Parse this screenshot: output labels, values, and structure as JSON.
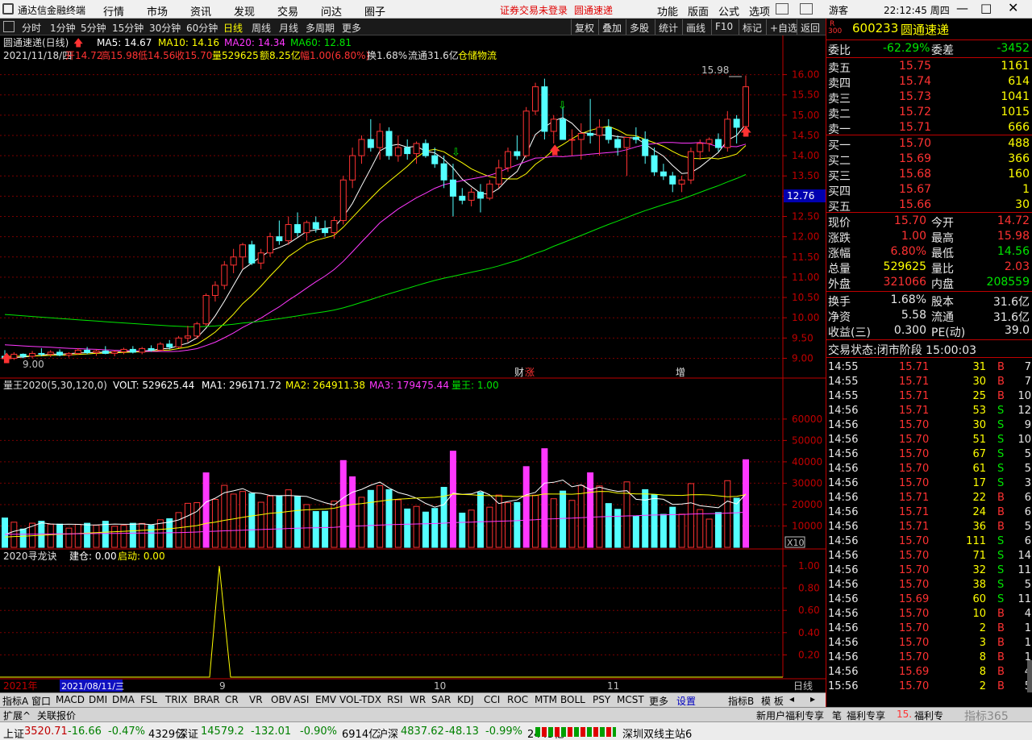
{
  "app": {
    "logo_label": "通达信金融终端",
    "menu": [
      "行情",
      "市场",
      "资讯",
      "发现",
      "交易",
      "问达",
      "圈子"
    ],
    "notice": "证券交易未登录",
    "notice_name": "圆通速递",
    "right_menu": [
      "功能",
      "版面",
      "公式",
      "选项"
    ],
    "user": "游客",
    "clock": "22:12:45 周四"
  },
  "periods": [
    "分时",
    "1分钟",
    "5分钟",
    "15分钟",
    "30分钟",
    "60分钟",
    "日线",
    "周线",
    "月线",
    "多周期",
    "更多"
  ],
  "active_period": "日线",
  "right_tools": [
    "复权",
    "叠加",
    "多股",
    "统计",
    "画线",
    "F10",
    "标记",
    "+自选",
    "返回"
  ],
  "main": {
    "name": "圆通速递(日线)",
    "ma5": "MA5: 14.67",
    "ma10": "MA10: 14.16",
    "ma20": "MA20: 14.34",
    "ma60": "MA60: 12.81",
    "info_date": "2021/11/18/四",
    "info_open": "开14.72",
    "info_high": "高15.98",
    "info_low": "低14.56",
    "info_close": "收15.70",
    "info_vol": "量529625",
    "info_amt": "额8.25亿",
    "info_pct": "幅1.00(6.80%)",
    "info_turn": "换1.68%",
    "info_float": "流通31.6亿",
    "info_sector": "仓储物流",
    "hi_label": "15.98",
    "lo_label": "9.00",
    "price_tag": "12.76",
    "mark_cai": "财",
    "mark_zhang": "涨",
    "mark_zeng": "增"
  },
  "vol": {
    "name": "量王2020(5,30,120,0)",
    "volt": "VOLT: 529625.44",
    "ma1": "MA1: 296171.72",
    "ma2": "MA2: 264911.38",
    "ma3": "MA3: 179475.44",
    "wang": "量王: 1.00",
    "unit": "X10"
  },
  "ind": {
    "name": "2020寻龙诀",
    "jiancang": "建仓: 0.00",
    "qidong": "启动: 0.00"
  },
  "xaxis": {
    "year": "2021年",
    "cursor_date": "2021/08/11/三",
    "m9": "9",
    "m10": "10",
    "m11": "11",
    "period": "日线"
  },
  "chart_data": {
    "type": "candlestick",
    "y_ticks": [
      16.0,
      15.5,
      15.0,
      14.5,
      14.0,
      13.5,
      13.0,
      12.5,
      12.0,
      11.5,
      11.0,
      10.5,
      10.0,
      9.5,
      9.0
    ],
    "ylim": [
      8.85,
      16.25
    ],
    "candles": [
      [
        9.05,
        9.2,
        8.97,
        9.0
      ],
      [
        9.0,
        9.15,
        8.96,
        9.1
      ],
      [
        9.1,
        9.12,
        9.0,
        9.05
      ],
      [
        9.05,
        9.18,
        9.0,
        9.12
      ],
      [
        9.12,
        9.25,
        9.05,
        9.1
      ],
      [
        9.1,
        9.2,
        9.03,
        9.15
      ],
      [
        9.15,
        9.22,
        9.05,
        9.08
      ],
      [
        9.08,
        9.15,
        9.02,
        9.12
      ],
      [
        9.12,
        9.25,
        9.08,
        9.2
      ],
      [
        9.2,
        9.28,
        9.1,
        9.14
      ],
      [
        9.14,
        9.22,
        9.06,
        9.18
      ],
      [
        9.18,
        9.3,
        9.1,
        9.12
      ],
      [
        9.12,
        9.2,
        9.05,
        9.16
      ],
      [
        9.16,
        9.26,
        9.1,
        9.22
      ],
      [
        9.22,
        9.3,
        9.12,
        9.15
      ],
      [
        9.15,
        9.28,
        9.1,
        9.24
      ],
      [
        9.24,
        9.32,
        9.16,
        9.2
      ],
      [
        9.2,
        9.4,
        9.18,
        9.35
      ],
      [
        9.35,
        9.45,
        9.22,
        9.28
      ],
      [
        9.28,
        9.55,
        9.25,
        9.5
      ],
      [
        9.5,
        9.8,
        9.4,
        9.55
      ],
      [
        9.55,
        9.9,
        9.48,
        9.85
      ],
      [
        9.85,
        10.6,
        9.8,
        10.55
      ],
      [
        10.55,
        10.9,
        10.4,
        10.8
      ],
      [
        10.8,
        11.4,
        10.7,
        11.3
      ],
      [
        11.3,
        11.7,
        11.1,
        11.5
      ],
      [
        11.5,
        11.85,
        11.2,
        11.8
      ],
      [
        11.8,
        11.9,
        11.3,
        11.35
      ],
      [
        11.35,
        11.7,
        11.2,
        11.6
      ],
      [
        11.6,
        12.1,
        11.5,
        12.0
      ],
      [
        12.0,
        12.4,
        11.8,
        11.9
      ],
      [
        11.9,
        12.5,
        11.8,
        12.3
      ],
      [
        12.3,
        12.6,
        12.0,
        12.1
      ],
      [
        12.1,
        12.4,
        11.9,
        12.35
      ],
      [
        12.35,
        12.5,
        12.1,
        12.2
      ],
      [
        12.2,
        12.4,
        12.0,
        12.1
      ],
      [
        12.1,
        12.5,
        11.95,
        12.4
      ],
      [
        12.4,
        13.5,
        12.3,
        13.4
      ],
      [
        13.4,
        14.2,
        13.2,
        14.0
      ],
      [
        14.0,
        14.5,
        13.8,
        14.4
      ],
      [
        14.4,
        14.9,
        14.1,
        14.2
      ],
      [
        14.2,
        14.8,
        13.9,
        14.6
      ],
      [
        14.6,
        14.7,
        13.9,
        14.0
      ],
      [
        14.0,
        14.5,
        13.85,
        14.2
      ],
      [
        14.2,
        14.4,
        13.9,
        14.05
      ],
      [
        14.05,
        14.35,
        13.8,
        14.3
      ],
      [
        14.3,
        14.4,
        13.95,
        14.0
      ],
      [
        14.0,
        14.2,
        13.7,
        13.8
      ],
      [
        13.8,
        14.0,
        13.2,
        13.4
      ],
      [
        13.4,
        13.8,
        12.5,
        13.0
      ],
      [
        13.0,
        13.2,
        12.8,
        12.9
      ],
      [
        12.9,
        13.2,
        12.75,
        13.1
      ],
      [
        13.1,
        13.3,
        12.6,
        12.95
      ],
      [
        12.95,
        13.4,
        12.9,
        13.3
      ],
      [
        13.3,
        13.9,
        13.2,
        13.7
      ],
      [
        13.7,
        14.2,
        13.6,
        14.1
      ],
      [
        14.1,
        14.5,
        13.9,
        14.0
      ],
      [
        14.0,
        15.2,
        13.95,
        15.1
      ],
      [
        15.1,
        15.8,
        15.0,
        15.7
      ],
      [
        15.7,
        15.9,
        14.4,
        14.6
      ],
      [
        14.6,
        15.0,
        14.3,
        14.9
      ],
      [
        14.9,
        15.2,
        14.4,
        14.4
      ],
      [
        14.4,
        14.65,
        14.0,
        14.4
      ],
      [
        14.4,
        14.8,
        13.9,
        14.55
      ],
      [
        14.55,
        15.4,
        14.3,
        14.5
      ],
      [
        14.5,
        14.9,
        14.0,
        14.7
      ],
      [
        14.7,
        14.9,
        14.3,
        14.4
      ],
      [
        14.4,
        14.5,
        14.0,
        14.2
      ],
      [
        14.2,
        14.45,
        13.5,
        14.45
      ],
      [
        14.45,
        14.7,
        14.3,
        14.4
      ],
      [
        14.4,
        14.6,
        13.8,
        14.0
      ],
      [
        14.0,
        14.2,
        13.5,
        13.6
      ],
      [
        13.6,
        13.8,
        13.4,
        13.5
      ],
      [
        13.5,
        13.6,
        13.1,
        13.3
      ],
      [
        13.3,
        13.5,
        13.1,
        13.4
      ],
      [
        13.4,
        14.2,
        13.3,
        14.1
      ],
      [
        14.1,
        14.4,
        13.9,
        14.3
      ],
      [
        14.3,
        14.45,
        14.1,
        14.4
      ],
      [
        14.4,
        14.55,
        14.1,
        14.2
      ],
      [
        14.2,
        15.1,
        14.1,
        14.9
      ],
      [
        14.9,
        15.0,
        14.3,
        14.7
      ],
      [
        14.72,
        15.98,
        14.56,
        15.7
      ]
    ],
    "ma_series": [
      {
        "name": "MA5",
        "color": "#ffffff"
      },
      {
        "name": "MA10",
        "color": "#ffff00"
      },
      {
        "name": "MA20",
        "color": "#ff38ff"
      },
      {
        "name": "MA60",
        "color": "#00e600"
      }
    ],
    "vol_ticks": [
      60000,
      50000,
      40000,
      30000,
      20000,
      10000
    ],
    "vol_ylim": [
      0,
      69000
    ],
    "ind_ticks": [
      1.0,
      0.8,
      0.6,
      0.4,
      0.2
    ]
  },
  "quote": {
    "code": "600233",
    "name": "圆通速递",
    "r_mark": "R",
    "market_no": "300",
    "wb_label": "委比",
    "wb": "-62.29%",
    "wc_label": "委差",
    "wc": "-3452",
    "asks": [
      {
        "label": "卖五",
        "price": "15.75",
        "vol": "1161"
      },
      {
        "label": "卖四",
        "price": "15.74",
        "vol": "614"
      },
      {
        "label": "卖三",
        "price": "15.73",
        "vol": "1041"
      },
      {
        "label": "卖二",
        "price": "15.72",
        "vol": "1015"
      },
      {
        "label": "卖一",
        "price": "15.71",
        "vol": "666"
      }
    ],
    "bids": [
      {
        "label": "买一",
        "price": "15.70",
        "vol": "488"
      },
      {
        "label": "买二",
        "price": "15.69",
        "vol": "366"
      },
      {
        "label": "买三",
        "price": "15.68",
        "vol": "160"
      },
      {
        "label": "买四",
        "price": "15.67",
        "vol": "1"
      },
      {
        "label": "买五",
        "price": "15.66",
        "vol": "30"
      }
    ],
    "stats": [
      [
        "现价",
        "15.70",
        "今开",
        "14.72"
      ],
      [
        "涨跌",
        "1.00",
        "最高",
        "15.98"
      ],
      [
        "涨幅",
        "6.80%",
        "最低",
        "14.56"
      ],
      [
        "总量",
        "529625",
        "量比",
        "2.03"
      ],
      [
        "外盘",
        "321066",
        "内盘",
        "208559"
      ]
    ],
    "stats2": [
      [
        "换手",
        "1.68%",
        "股本",
        "31.6亿"
      ],
      [
        "净资",
        "5.58",
        "流通",
        "31.6亿"
      ],
      [
        "收益(三)",
        "0.300",
        "PE(动)",
        "39.0"
      ]
    ],
    "trade_status": "交易状态:闭市阶段 15:00:03"
  },
  "ticks": [
    [
      "14:55",
      "15.71",
      "31",
      "B",
      "7"
    ],
    [
      "14:55",
      "15.71",
      "30",
      "B",
      "7"
    ],
    [
      "14:55",
      "15.71",
      "25",
      "B",
      "10"
    ],
    [
      "14:56",
      "15.71",
      "53",
      "S",
      "12"
    ],
    [
      "14:56",
      "15.70",
      "30",
      "S",
      "9"
    ],
    [
      "14:56",
      "15.70",
      "51",
      "S",
      "10"
    ],
    [
      "14:56",
      "15.70",
      "67",
      "S",
      "5"
    ],
    [
      "14:56",
      "15.70",
      "61",
      "S",
      "5"
    ],
    [
      "14:56",
      "15.70",
      "17",
      "S",
      "3"
    ],
    [
      "14:56",
      "15.71",
      "22",
      "B",
      "6"
    ],
    [
      "14:56",
      "15.71",
      "24",
      "B",
      "6"
    ],
    [
      "14:56",
      "15.71",
      "36",
      "B",
      "5"
    ],
    [
      "14:56",
      "15.70",
      "111",
      "S",
      "6"
    ],
    [
      "14:56",
      "15.70",
      "71",
      "S",
      "14"
    ],
    [
      "14:56",
      "15.70",
      "32",
      "S",
      "11"
    ],
    [
      "14:56",
      "15.70",
      "38",
      "S",
      "5"
    ],
    [
      "14:56",
      "15.69",
      "60",
      "S",
      "11"
    ],
    [
      "14:56",
      "15.70",
      "10",
      "B",
      "4"
    ],
    [
      "14:56",
      "15.70",
      "2",
      "B",
      "1"
    ],
    [
      "14:56",
      "15.70",
      "3",
      "B",
      "1"
    ],
    [
      "14:56",
      "15.70",
      "8",
      "B",
      "1"
    ],
    [
      "14:56",
      "15.69",
      "8",
      "B",
      "4"
    ],
    [
      "15:56",
      "15.70",
      "2",
      "B",
      "5"
    ]
  ],
  "tabs": [
    "指标A",
    "窗口",
    "MACD",
    "DMI",
    "DMA",
    "FSL",
    "TRIX",
    "BRAR",
    "CR",
    "VR",
    "OBV",
    "ASI",
    "EMV",
    "VOL-TDX",
    "RSI",
    "WR",
    "SAR",
    "KDJ",
    "CCI",
    "ROC",
    "MTM",
    "BOLL",
    "PSY",
    "MCST",
    "更多",
    "设置",
    "指标B",
    "模 板"
  ],
  "tabs2": [
    "扩展^",
    "关联报价",
    "新用户福利专享",
    "笔",
    "福利专享",
    "15.",
    "福利专",
    "指标365"
  ],
  "status": {
    "sh_name": "上证",
    "sh": "3520.71",
    "sh_chg": "-16.66",
    "sh_pct": "-0.47%",
    "sh_amt": "4329亿",
    "sz_name": "深证",
    "sz": "14579.2",
    "sz_chg": "-132.01",
    "sz_pct": "-0.90%",
    "sz_amt": "6914亿",
    "hs_name": "沪深",
    "hs": "4837.62",
    "hs_chg": "-48.13",
    "hs_pct": "-0.99%",
    "hs_amt": "2445亿",
    "station": "深圳双线主站6"
  }
}
